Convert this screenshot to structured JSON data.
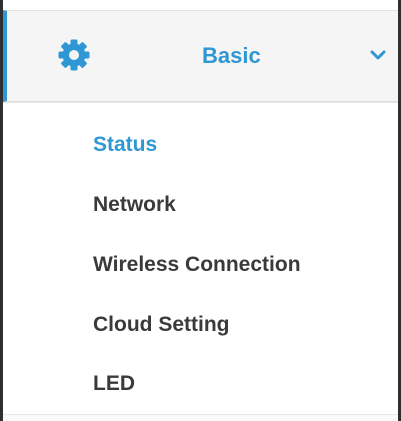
{
  "menu": {
    "section": {
      "label": "Basic",
      "icon": "gear-icon",
      "expand_icon": "chevron-down-icon",
      "expanded": true,
      "accent_color": "#2f97d3"
    },
    "items": [
      {
        "label": "Status",
        "active": true
      },
      {
        "label": "Network",
        "active": false
      },
      {
        "label": "Wireless Connection",
        "active": false
      },
      {
        "label": "Cloud Setting",
        "active": false
      },
      {
        "label": "LED",
        "active": false
      }
    ],
    "text_color": "#3a3a3a",
    "active_color": "#2f97d3"
  }
}
